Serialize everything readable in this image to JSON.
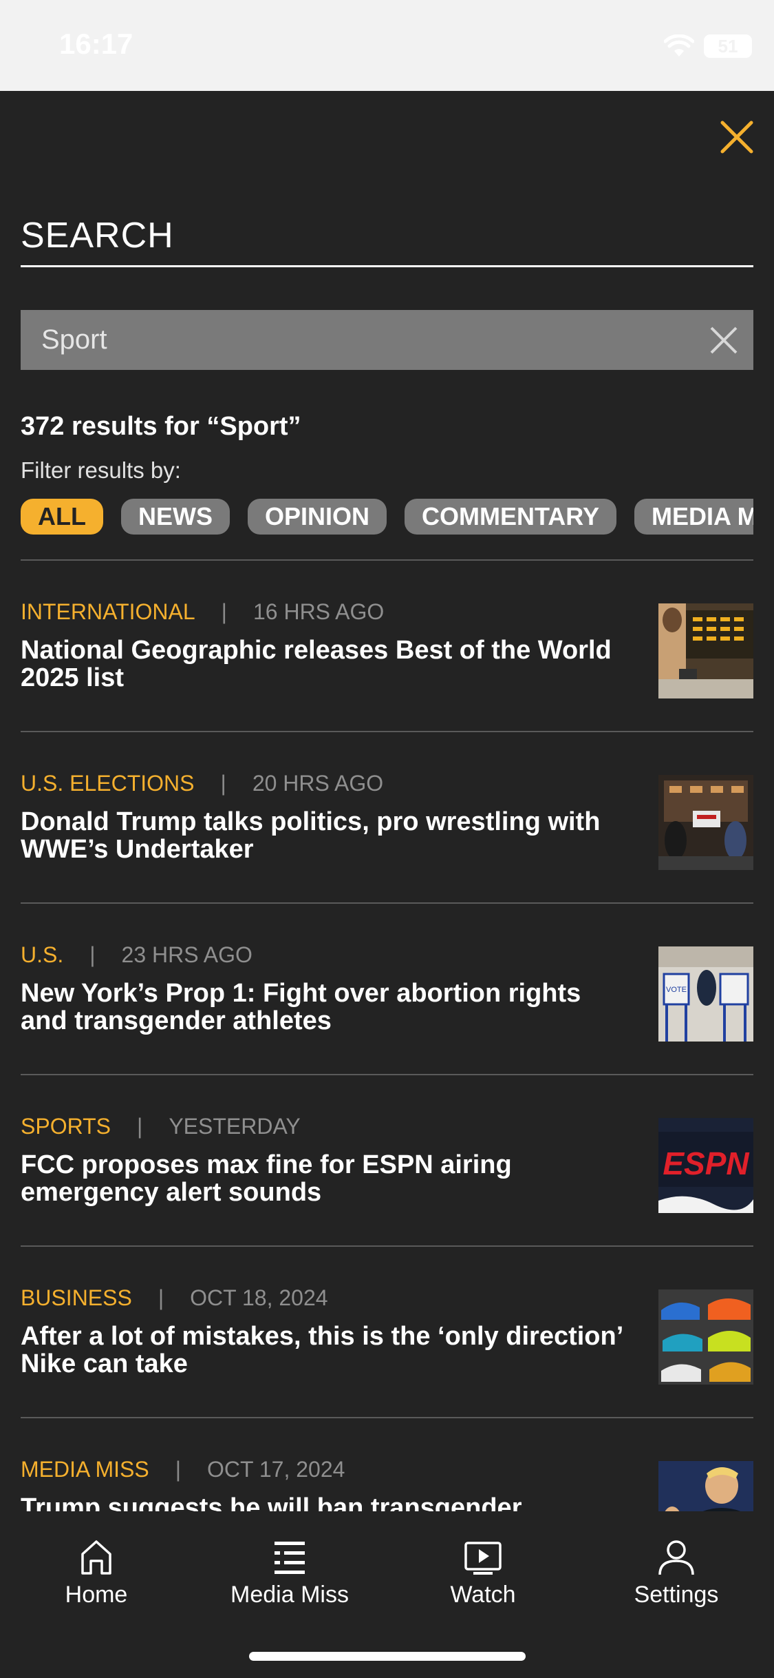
{
  "status_bar": {
    "time": "16:17",
    "battery": "51"
  },
  "search": {
    "heading": "SEARCH",
    "query": "Sport",
    "results_count": "372 results for “Sport”",
    "filter_label": "Filter results by:"
  },
  "filters": [
    {
      "label": "ALL",
      "active": true
    },
    {
      "label": "NEWS",
      "active": false
    },
    {
      "label": "OPINION",
      "active": false
    },
    {
      "label": "COMMENTARY",
      "active": false
    },
    {
      "label": "MEDIA MISS",
      "active": false
    }
  ],
  "articles": [
    {
      "category": "INTERNATIONAL",
      "time": "16 HRS AGO",
      "headline": "National Geographic releases Best of the World 2025 list"
    },
    {
      "category": "U.S. ELECTIONS",
      "time": "20 HRS AGO",
      "headline": "Donald Trump talks politics, pro wrestling with WWE’s Undertaker"
    },
    {
      "category": "U.S.",
      "time": "23 HRS AGO",
      "headline": "New York’s Prop 1: Fight over abortion rights and transgender athletes"
    },
    {
      "category": "SPORTS",
      "time": "YESTERDAY",
      "headline": "FCC proposes max fine for ESPN airing emergency alert sounds"
    },
    {
      "category": "BUSINESS",
      "time": "OCT 18, 2024",
      "headline": "After a lot of mistakes, this is the ‘only direction’ Nike can take"
    },
    {
      "category": "MEDIA MISS",
      "time": "OCT 17, 2024",
      "headline": "Trump suggests he will ban transgender"
    }
  ],
  "thumbnail_texts": {
    "espn": "ESPN",
    "vote": "VOTE"
  },
  "separator": "|",
  "tab_bar": {
    "home": "Home",
    "media_miss": "Media Miss",
    "watch": "Watch",
    "settings": "Settings"
  },
  "colors": {
    "accent": "#f5b02e",
    "background": "#232323",
    "chip": "#7a7a7a"
  }
}
